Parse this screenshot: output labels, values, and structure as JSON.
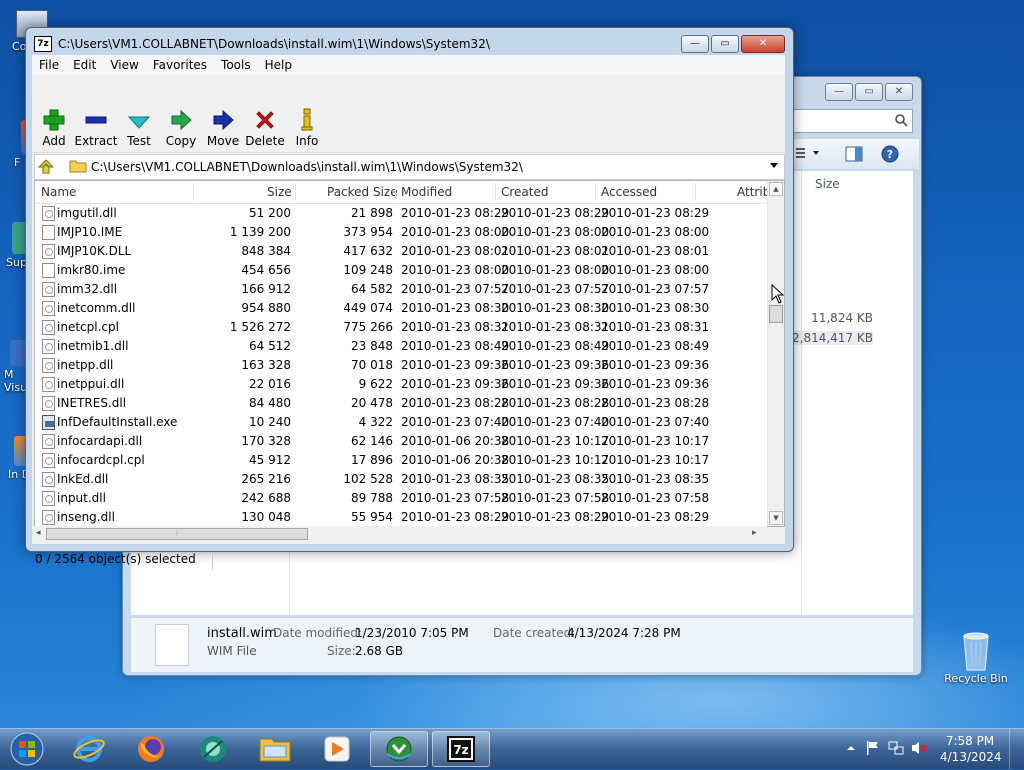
{
  "desktop": {
    "icons": [
      {
        "label": "Co"
      },
      {
        "label": "F"
      },
      {
        "label": "Sup"
      },
      {
        "label": "M Visu"
      },
      {
        "label": "In Do"
      },
      {
        "label": "Recycle Bin"
      }
    ]
  },
  "explorer": {
    "size_header": "Size",
    "values": [
      "11,824 KB",
      "2,814,417 KB"
    ],
    "details": {
      "filename": "install.wim",
      "type": "WIM File",
      "modified_label": "Date modified:",
      "modified_value": "1/23/2010 7:05 PM",
      "created_label": "Date created:",
      "created_value": "4/13/2024 7:28 PM",
      "size_label": "Size:",
      "size_value": "2.68 GB"
    }
  },
  "sevenzip": {
    "title": "C:\\Users\\VM1.COLLABNET\\Downloads\\install.wim\\1\\Windows\\System32\\",
    "logo": "7z",
    "menu": [
      "File",
      "Edit",
      "View",
      "Favorites",
      "Tools",
      "Help"
    ],
    "toolbar": {
      "add": "Add",
      "extract": "Extract",
      "test": "Test",
      "copy": "Copy",
      "move": "Move",
      "delete": "Delete",
      "info": "Info"
    },
    "path": "C:\\Users\\VM1.COLLABNET\\Downloads\\install.wim\\1\\Windows\\System32\\",
    "columns": {
      "name": "Name",
      "size": "Size",
      "packed": "Packed Size",
      "modified": "Modified",
      "created": "Created",
      "accessed": "Accessed",
      "attrib": "Attrib"
    },
    "rows": [
      {
        "name": "imgutil.dll",
        "size": "51 200",
        "packed": "21 898",
        "modified": "2010-01-23 08:29",
        "created": "2010-01-23 08:29",
        "accessed": "2010-01-23 08:29",
        "icon": "dll"
      },
      {
        "name": "IMJP10.IME",
        "size": "1 139 200",
        "packed": "373 954",
        "modified": "2010-01-23 08:00",
        "created": "2010-01-23 08:00",
        "accessed": "2010-01-23 08:00",
        "icon": "plain"
      },
      {
        "name": "IMJP10K.DLL",
        "size": "848 384",
        "packed": "417 632",
        "modified": "2010-01-23 08:01",
        "created": "2010-01-23 08:01",
        "accessed": "2010-01-23 08:01",
        "icon": "dll"
      },
      {
        "name": "imkr80.ime",
        "size": "454 656",
        "packed": "109 248",
        "modified": "2010-01-23 08:00",
        "created": "2010-01-23 08:00",
        "accessed": "2010-01-23 08:00",
        "icon": "plain"
      },
      {
        "name": "imm32.dll",
        "size": "166 912",
        "packed": "64 582",
        "modified": "2010-01-23 07:57",
        "created": "2010-01-23 07:57",
        "accessed": "2010-01-23 07:57",
        "icon": "dll"
      },
      {
        "name": "inetcomm.dll",
        "size": "954 880",
        "packed": "449 074",
        "modified": "2010-01-23 08:30",
        "created": "2010-01-23 08:30",
        "accessed": "2010-01-23 08:30",
        "icon": "dll"
      },
      {
        "name": "inetcpl.cpl",
        "size": "1 526 272",
        "packed": "775 266",
        "modified": "2010-01-23 08:31",
        "created": "2010-01-23 08:31",
        "accessed": "2010-01-23 08:31",
        "icon": "dll"
      },
      {
        "name": "inetmib1.dll",
        "size": "64 512",
        "packed": "23 848",
        "modified": "2010-01-23 08:49",
        "created": "2010-01-23 08:49",
        "accessed": "2010-01-23 08:49",
        "icon": "dll"
      },
      {
        "name": "inetpp.dll",
        "size": "163 328",
        "packed": "70 018",
        "modified": "2010-01-23 09:36",
        "created": "2010-01-23 09:36",
        "accessed": "2010-01-23 09:36",
        "icon": "dll"
      },
      {
        "name": "inetppui.dll",
        "size": "22 016",
        "packed": "9 622",
        "modified": "2010-01-23 09:36",
        "created": "2010-01-23 09:36",
        "accessed": "2010-01-23 09:36",
        "icon": "dll"
      },
      {
        "name": "INETRES.dll",
        "size": "84 480",
        "packed": "20 478",
        "modified": "2010-01-23 08:28",
        "created": "2010-01-23 08:28",
        "accessed": "2010-01-23 08:28",
        "icon": "dll"
      },
      {
        "name": "InfDefaultInstall.exe",
        "size": "10 240",
        "packed": "4 322",
        "modified": "2010-01-23 07:40",
        "created": "2010-01-23 07:40",
        "accessed": "2010-01-23 07:40",
        "icon": "exe"
      },
      {
        "name": "infocardapi.dll",
        "size": "170 328",
        "packed": "62 146",
        "modified": "2010-01-06 20:38",
        "created": "2010-01-23 10:17",
        "accessed": "2010-01-23 10:17",
        "icon": "dll"
      },
      {
        "name": "infocardcpl.cpl",
        "size": "45 912",
        "packed": "17 896",
        "modified": "2010-01-06 20:38",
        "created": "2010-01-23 10:17",
        "accessed": "2010-01-23 10:17",
        "icon": "dll"
      },
      {
        "name": "InkEd.dll",
        "size": "265 216",
        "packed": "102 528",
        "modified": "2010-01-23 08:35",
        "created": "2010-01-23 08:35",
        "accessed": "2010-01-23 08:35",
        "icon": "dll"
      },
      {
        "name": "input.dll",
        "size": "242 688",
        "packed": "89 788",
        "modified": "2010-01-23 07:58",
        "created": "2010-01-23 07:58",
        "accessed": "2010-01-23 07:58",
        "icon": "dll"
      },
      {
        "name": "inseng.dll",
        "size": "130 048",
        "packed": "55 954",
        "modified": "2010-01-23 08:29",
        "created": "2010-01-23 08:29",
        "accessed": "2010-01-23 08:29",
        "icon": "dll"
      }
    ],
    "status": "0 / 2564 object(s) selected"
  },
  "taskbar": {
    "time": "7:58 PM",
    "date": "4/13/2024",
    "items": [
      "start-orb",
      "internet-explorer-icon",
      "firefox-icon",
      "app-icon",
      "file-explorer-icon",
      "media-player-icon",
      "download-manager-icon",
      "seven-zip-icon"
    ]
  },
  "colors": {
    "desktop": "#1566c2",
    "window_frame": "#c4d6ea",
    "close_button": "#c7432c",
    "add_green": "#1aa11a",
    "move_blue": "#1a2fa8",
    "delete_red": "#d01818"
  }
}
